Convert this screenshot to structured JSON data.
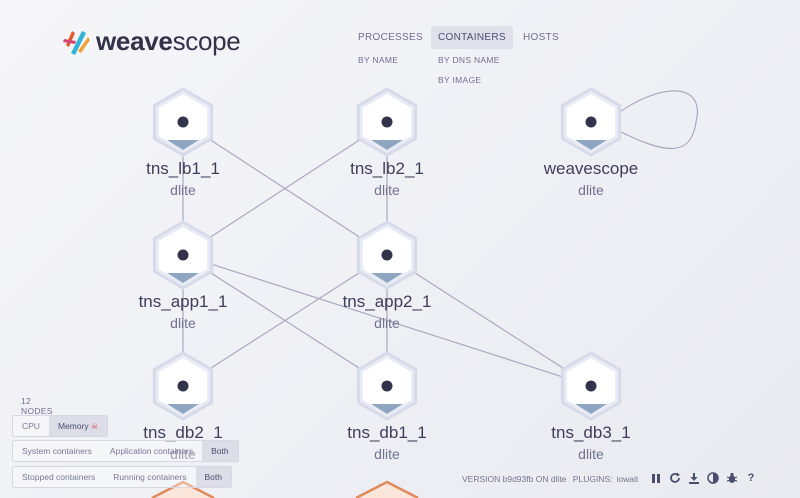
{
  "brand": {
    "name_bold": "weave",
    "name_rest": "scope"
  },
  "nav": {
    "main": [
      {
        "label": "PROCESSES",
        "active": false
      },
      {
        "label": "CONTAINERS",
        "active": true
      },
      {
        "label": "HOSTS",
        "active": false
      }
    ],
    "sub": [
      "BY NAME",
      "BY DNS NAME",
      "BY IMAGE"
    ]
  },
  "nodes": [
    {
      "id": "tns_lb1_1",
      "label": "tns_lb1_1",
      "sub": "dlite"
    },
    {
      "id": "tns_lb2_1",
      "label": "tns_lb2_1",
      "sub": "dlite"
    },
    {
      "id": "weavescope",
      "label": "weavescope",
      "sub": "dlite"
    },
    {
      "id": "tns_app1_1",
      "label": "tns_app1_1",
      "sub": "dlite"
    },
    {
      "id": "tns_app2_1",
      "label": "tns_app2_1",
      "sub": "dlite"
    },
    {
      "id": "tns_db2_1",
      "label": "tns_db2_1",
      "sub": "dlite"
    },
    {
      "id": "tns_db1_1",
      "label": "tns_db1_1",
      "sub": "dlite"
    },
    {
      "id": "tns_db3_1",
      "label": "tns_db3_1",
      "sub": "dlite"
    }
  ],
  "edges": [
    [
      "tns_lb1_1",
      "tns_app1_1"
    ],
    [
      "tns_lb1_1",
      "tns_app2_1"
    ],
    [
      "tns_lb2_1",
      "tns_app1_1"
    ],
    [
      "tns_lb2_1",
      "tns_app2_1"
    ],
    [
      "tns_app1_1",
      "tns_db2_1"
    ],
    [
      "tns_app1_1",
      "tns_db1_1"
    ],
    [
      "tns_app1_1",
      "tns_db3_1"
    ],
    [
      "tns_app2_1",
      "tns_db2_1"
    ],
    [
      "tns_app2_1",
      "tns_db1_1"
    ],
    [
      "tns_app2_1",
      "tns_db3_1"
    ],
    [
      "weavescope",
      "weavescope"
    ]
  ],
  "controls": {
    "node_count": "12 NODES",
    "metric": [
      {
        "label": "CPU",
        "active": false
      },
      {
        "label": "Memory",
        "active": true
      }
    ],
    "container_type": [
      {
        "label": "System containers",
        "active": false
      },
      {
        "label": "Application containers",
        "active": false
      },
      {
        "label": "Both",
        "active": true
      }
    ],
    "container_state": [
      {
        "label": "Stopped containers",
        "active": false
      },
      {
        "label": "Running containers",
        "active": false
      },
      {
        "label": "Both",
        "active": true
      }
    ],
    "pin_icon": "pin-icon"
  },
  "footer": {
    "version_text": "VERSION b9d93fb ON dlite",
    "plugins_label": "PLUGINS:",
    "plugins_value": "iowait",
    "tools": [
      "pause-icon",
      "refresh-icon",
      "download-icon",
      "contrast-icon",
      "debug-icon",
      "help-icon"
    ]
  },
  "colors": {
    "accent": "#4b4f73",
    "node_fill": "#ffffff",
    "node_ring": "#d7dbe9",
    "dot": "#32324b",
    "memory_fill": "#8fa6c2",
    "edge": "#a7a9c0",
    "partial_node": "#e0895a"
  }
}
